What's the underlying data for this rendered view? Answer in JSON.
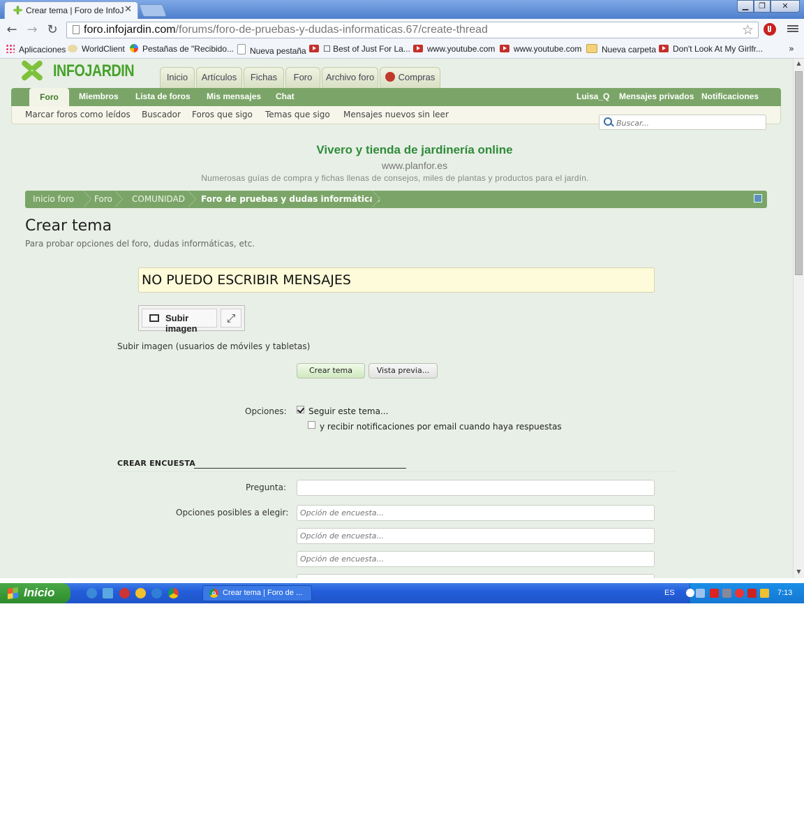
{
  "browser": {
    "tab_title": "Crear tema | Foro de InfoJardín",
    "tab_close": "✕",
    "url_host": "foro.infojardin.com",
    "url_path": "/forums/foro-de-pruebas-y-dudas-informaticas.67/create-thread",
    "bookmarks": [
      {
        "label": "Aplicaciones",
        "icon": "apps-icon"
      },
      {
        "label": "WorldClient",
        "icon": "worldclient-icon"
      },
      {
        "label": "Pestañas de \"Recibido...",
        "icon": "google-icon"
      },
      {
        "label": "Nueva pestaña",
        "icon": "page-icon"
      },
      {
        "label": "☐ Best of Just For La...",
        "icon": "youtube-icon"
      },
      {
        "label": "www.youtube.com",
        "icon": "youtube-icon"
      },
      {
        "label": "www.youtube.com",
        "icon": "youtube-icon"
      },
      {
        "label": "Nueva carpeta",
        "icon": "folder-icon"
      },
      {
        "label": "Don't Look At My Girlfr...",
        "icon": "youtube-icon"
      }
    ],
    "bookmarks_more": "»"
  },
  "site": {
    "logo_text": "INFOJARDIN",
    "top_tabs": [
      "Inicio",
      "Artículos",
      "Fichas",
      "Foro",
      "Archivo foro",
      "Compras"
    ],
    "nav": {
      "active": "Foro",
      "items": [
        "Miembros",
        "Lista de foros",
        "Mis mensajes",
        "Chat"
      ],
      "user": "Luisa_Q",
      "private_messages": "Mensajes privados",
      "notifications": "Notificaciones"
    },
    "subnav": [
      "Marcar foros como leídos",
      "Buscador",
      "Foros que sigo",
      "Temas que sigo",
      "Mensajes nuevos sin leer"
    ],
    "search_placeholder": "Buscar..."
  },
  "ad": {
    "title": "Vivero y tienda de jardinería online",
    "url": "www.planfor.es",
    "description": "Numerosas guías de compra y fichas llenas de consejos, miles de plantas y productos para el jardín."
  },
  "breadcrumb": [
    "Inicio foro",
    "Foro",
    "COMUNIDAD",
    "Foro de pruebas y dudas informáticas"
  ],
  "page": {
    "title": "Crear tema",
    "description": "Para probar opciones del foro, dudas informáticas, etc."
  },
  "form": {
    "title_value": "NO PUEDO ESCRIBIR MENSAJES",
    "upload_label": "Subir imagen",
    "upload_mobile": "Subir imagen (usuarios de móviles y tabletas)",
    "create_button": "Crear tema",
    "preview_button": "Vista previa...",
    "options_label": "Opciones:",
    "follow_label": "Seguir este tema...",
    "follow_checked": true,
    "email_label": "y recibir notificaciones por email cuando haya respuestas",
    "email_checked": false,
    "poll_heading": "CREAR ENCUESTA",
    "question_label": "Pregunta:",
    "question_value": "",
    "options_possible_label": "Opciones posibles a elegir:",
    "poll_option_placeholder": "Opción de encuesta..."
  },
  "taskbar": {
    "start_label": "Inicio",
    "task_label": "Crear tema | Foro de ...",
    "language": "ES",
    "clock": "7:13"
  },
  "colors": {
    "nav_green": "#7ba568",
    "page_bg": "#e8efe6",
    "ad_title": "#2e8b3a",
    "taskbar_blue": "#245edb"
  }
}
